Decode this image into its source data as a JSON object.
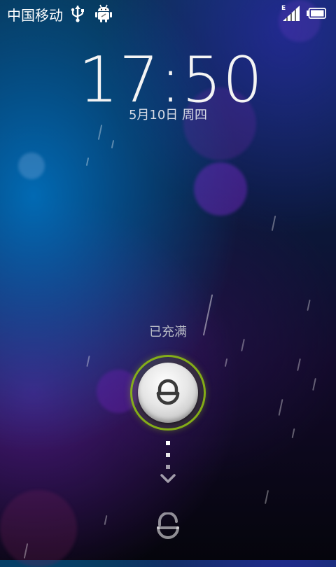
{
  "status_bar": {
    "carrier": "中国移动",
    "icons": [
      "usb-icon",
      "android-debug-icon",
      "signal-icon",
      "battery-icon"
    ],
    "network_type": "E"
  },
  "lockscreen": {
    "time": "17:50",
    "date": "5月10日 周四",
    "charge_status": "已充满",
    "unlock_icon": "lock-icon",
    "hint_icon": "chevron-down-icon",
    "bottom_icon": "unlock-icon"
  },
  "colors": {
    "accent_ring": "#8cb914",
    "text_primary": "#f4f4f4",
    "text_secondary": "#b9bcc6"
  }
}
